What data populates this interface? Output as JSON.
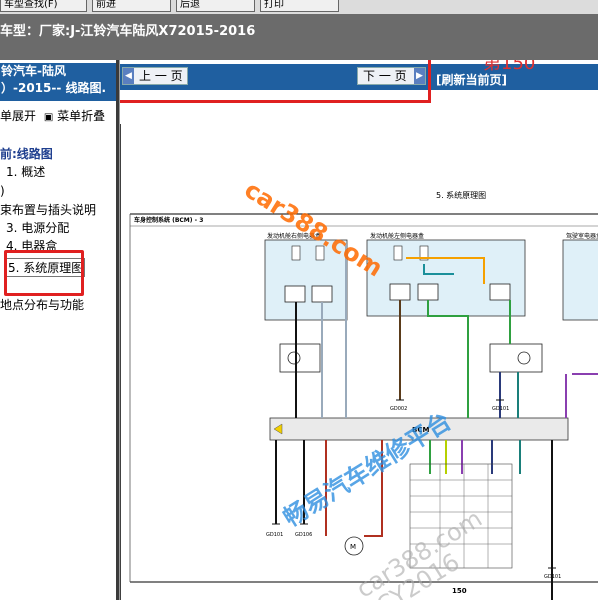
{
  "toolbar": {
    "buttons": [
      "车型查找(F)",
      "前进",
      "后退",
      "打印"
    ]
  },
  "vehicle_bar": {
    "text": "车型：厂家:J-江铃汽车陆风X72015-2016"
  },
  "sidebar": {
    "header_line1": "铃汽车-陆风",
    "header_line2": "）-2015-- 线路图.",
    "menu_expand": "单展开",
    "menu_collapse": "菜单折叠",
    "menu_marker": "▣",
    "current_label": "前:线路图",
    "items": [
      {
        "label": "1. 概述"
      },
      {
        "label": ")"
      },
      {
        "label": "束布置与插头说明"
      },
      {
        "label": "3. 电源分配"
      },
      {
        "label": "4. 电器盒"
      },
      {
        "label": "5. 系统原理图"
      },
      {
        "label": "地点分布与功能"
      }
    ]
  },
  "nav": {
    "prev_label": "上 一 页",
    "next_label": "下 一 页",
    "refresh_label": "[刷新当前页]",
    "page_annotation": "第150"
  },
  "diagram": {
    "section_title": "5. 系统原理图",
    "subtitle": "车身控制系统 (BCM) - 3",
    "box1_label": "发动机舱右侧电器盒",
    "box2_label": "发动机舱左侧电器盒",
    "box3_label": "驾驶室电器盒",
    "bcm_label": "BCM",
    "ground_labels": [
      "GD101",
      "GD106",
      "GD002",
      "GD101",
      "GD101"
    ],
    "page_number": "150"
  },
  "watermarks": {
    "wm1": "car388.com",
    "wm2": "畅易汽车维修平台",
    "wm3": "car388.com",
    "wm4": "CY2016"
  },
  "colors": {
    "header_blue": "#1f5fa0",
    "annotation_red": "#e02020",
    "watermark_orange": "#ff6a00",
    "watermark_blue": "#2f8fe0"
  }
}
